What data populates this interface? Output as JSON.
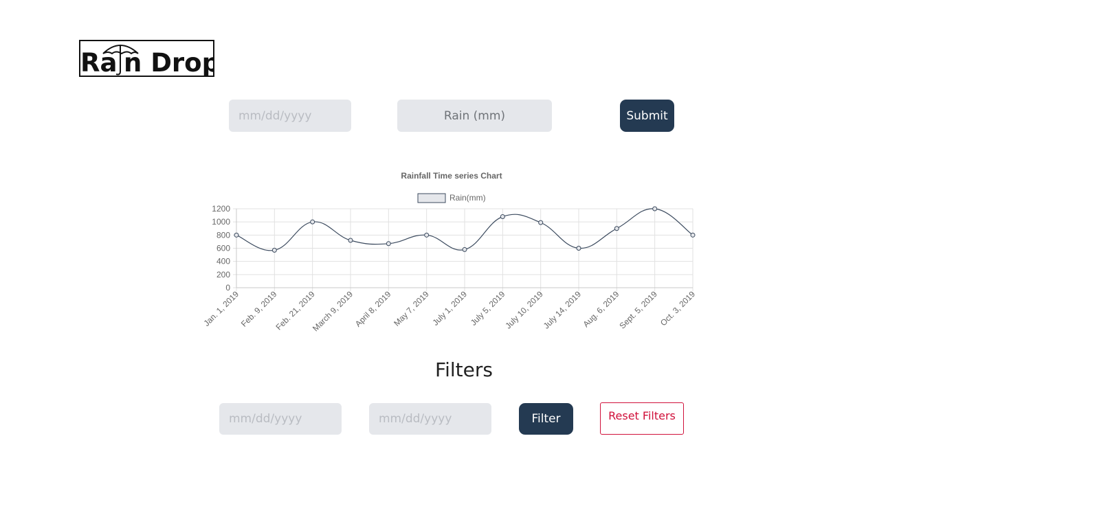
{
  "logo": {
    "text": "Rain Drop"
  },
  "entry_form": {
    "date_placeholder": "mm/dd/yyyy",
    "rain_placeholder": "Rain (mm)",
    "submit_label": "Submit"
  },
  "filters": {
    "title": "Filters",
    "start_date_placeholder": "mm/dd/yyyy",
    "end_date_placeholder": "mm/dd/yyyy",
    "filter_label": "Filter",
    "reset_label": "Reset Filters"
  },
  "colors": {
    "primary_button": "#243a52",
    "reset_button": "#d0103a",
    "input_background": "#e5e7eb",
    "series_line": "#3b4a5e"
  },
  "chart_data": {
    "type": "line",
    "title": "Rainfall Time series Chart",
    "legend_position": "top",
    "grid": true,
    "categories": [
      "Jan. 1, 2019",
      "Feb. 9, 2019",
      "Feb. 21, 2019",
      "March 9, 2019",
      "April 8, 2019",
      "May 7, 2019",
      "July 1, 2019",
      "July 5, 2019",
      "July 10, 2019",
      "July 14, 2019",
      "Aug. 6, 2019",
      "Sept. 5, 2019",
      "Oct. 3, 2019"
    ],
    "series": [
      {
        "name": "Rain(mm)",
        "values": [
          800,
          570,
          1000,
          720,
          670,
          800,
          580,
          1080,
          990,
          600,
          900,
          1200,
          800
        ]
      }
    ],
    "ylim": [
      0,
      1200
    ],
    "yticks": [
      "0",
      "200",
      "400",
      "600",
      "800",
      "1000",
      "1200"
    ]
  }
}
